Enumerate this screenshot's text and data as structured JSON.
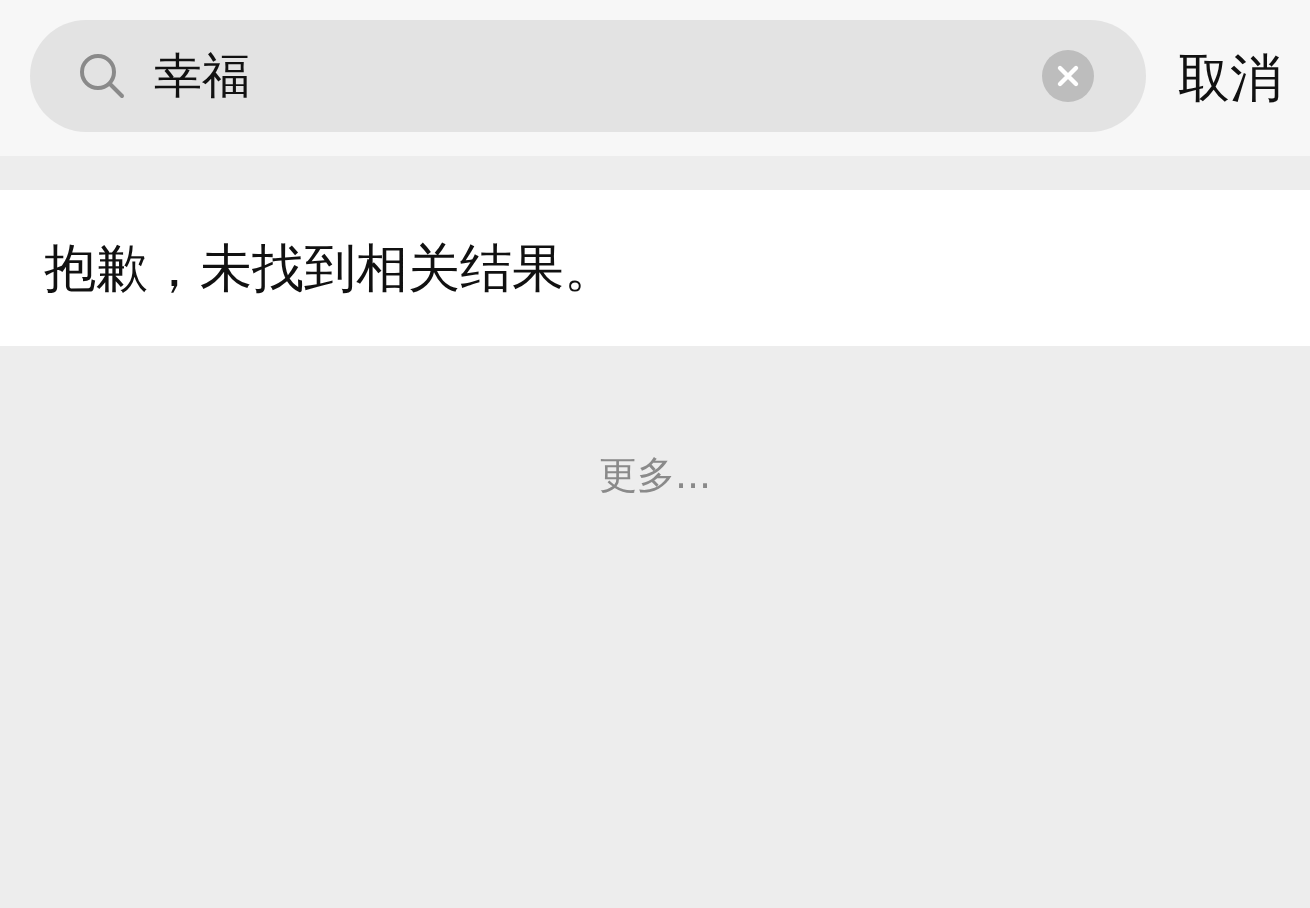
{
  "search": {
    "value": "幸福",
    "cancel": "取消"
  },
  "result": {
    "message": "抱歉，未找到相关结果。"
  },
  "more": "更多..."
}
